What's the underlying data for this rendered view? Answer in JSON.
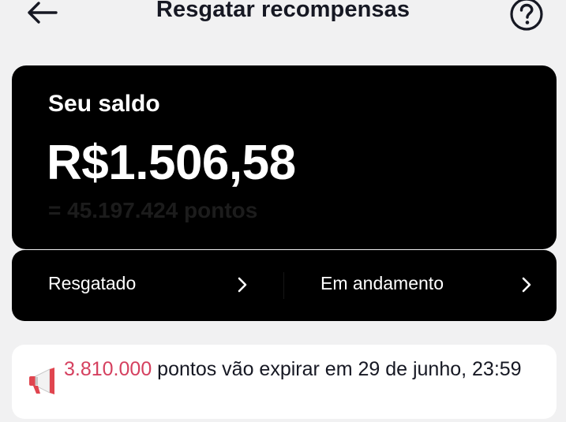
{
  "header": {
    "title": "Resgatar recompensas",
    "back_icon": "arrow-left-icon",
    "help_icon": "question-circle-icon"
  },
  "balance": {
    "label": "Seu saldo",
    "amount": "R$1.506,58",
    "points": "= 45.197.424 pontos"
  },
  "status": {
    "redeemed_label": "Resgatado",
    "in_progress_label": "Em andamento"
  },
  "notice": {
    "icon": "megaphone-icon",
    "points": "3.810.000",
    "text": " pontos vão expirar em 29 de junho, 23:59"
  },
  "colors": {
    "background": "#f1f1f2",
    "card": "#000000",
    "accent_points": "#d5405f"
  }
}
